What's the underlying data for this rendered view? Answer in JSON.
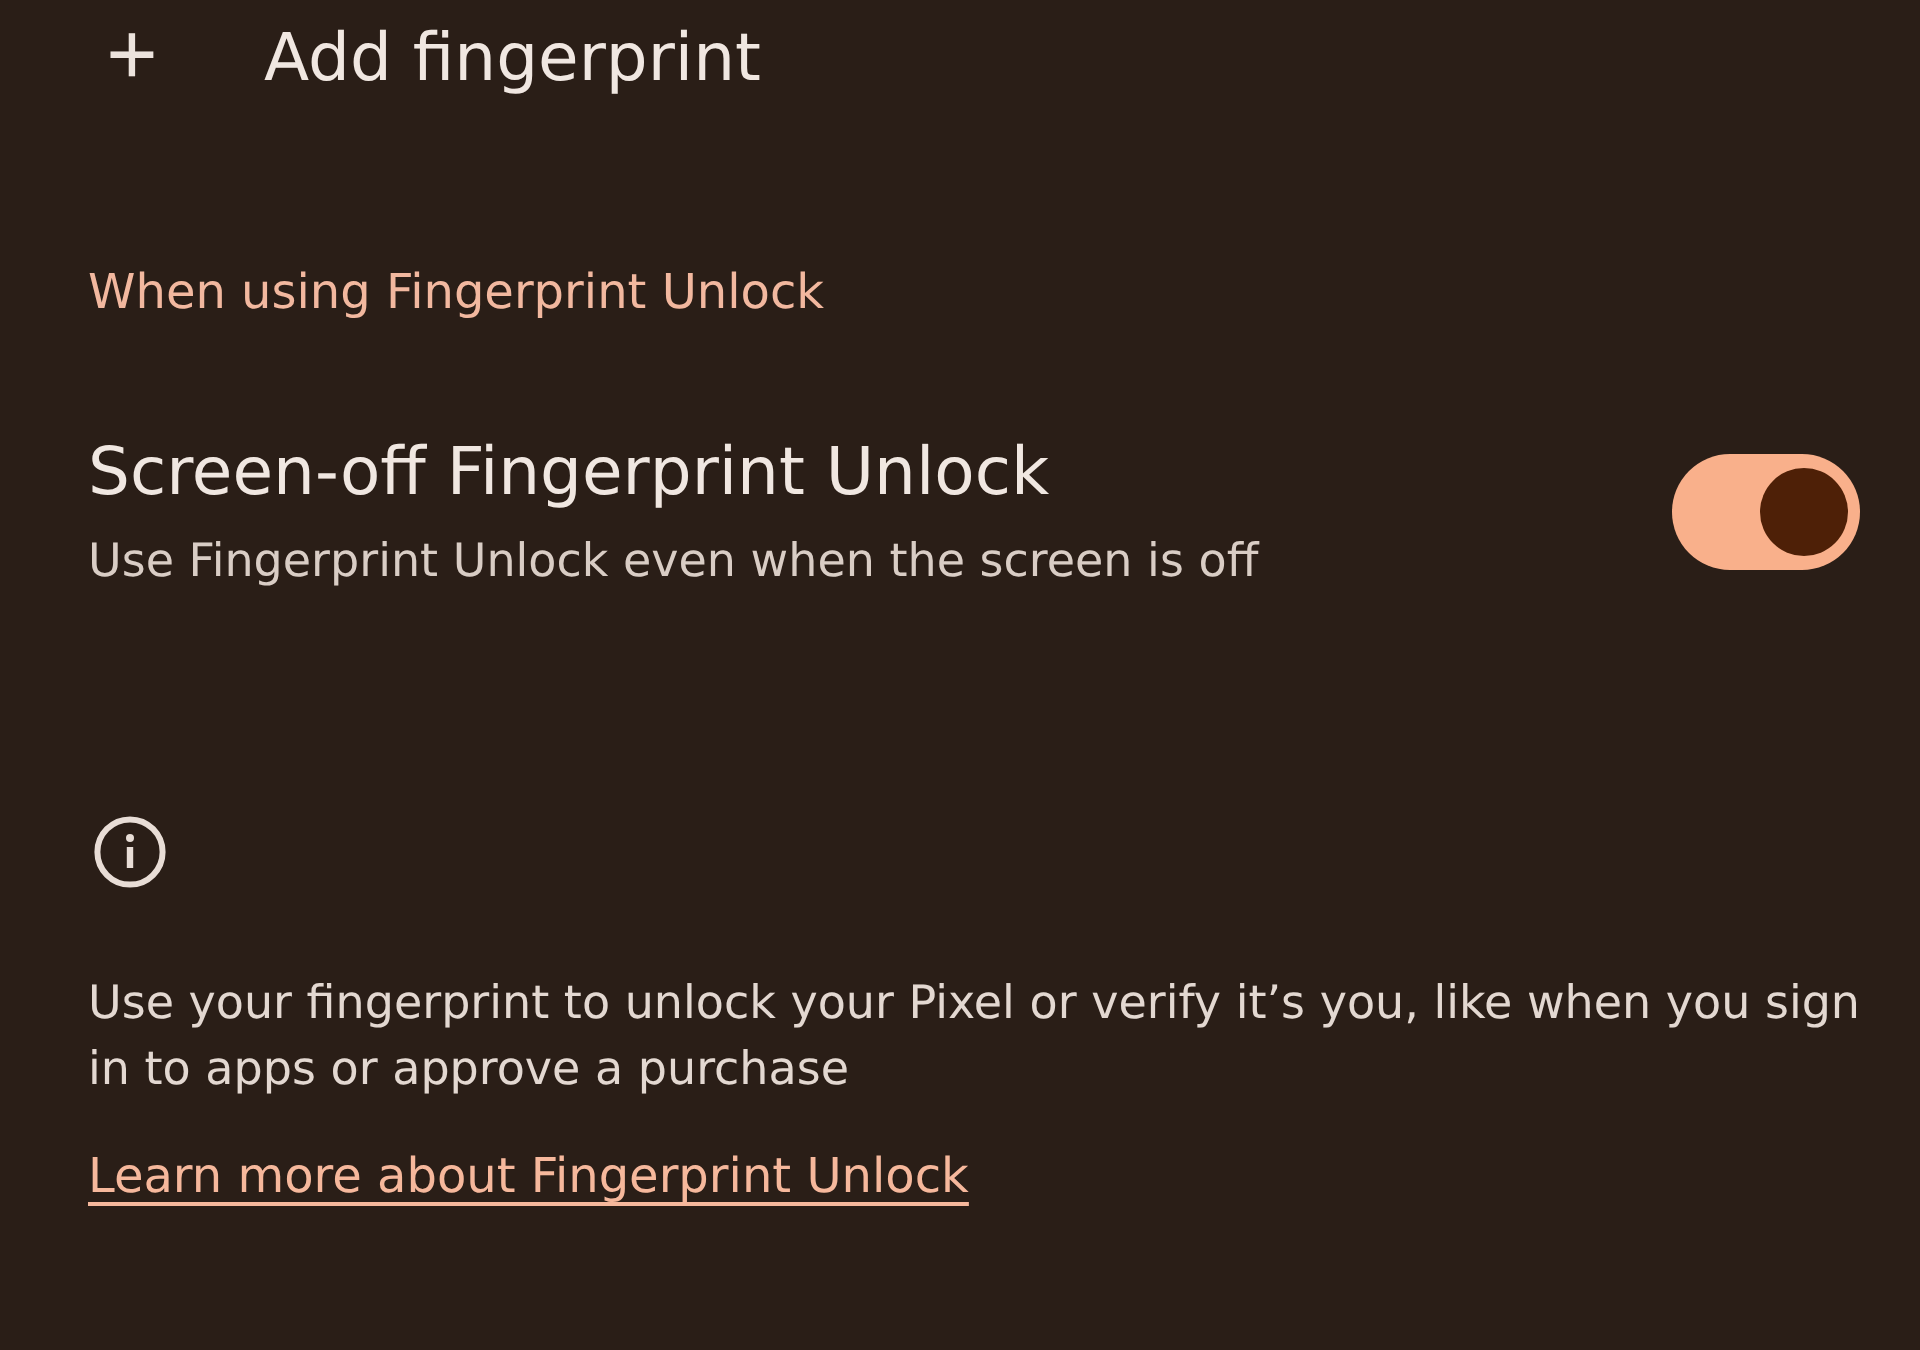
{
  "add_item": {
    "icon": "+",
    "label": "Add fingerprint"
  },
  "section_header": "When using Fingerprint Unlock",
  "settings": [
    {
      "title": "Screen-off Fingerprint Unlock",
      "summary": "Use Fingerprint Unlock even when the screen is off",
      "on": true
    }
  ],
  "footer": {
    "text": "Use your fingerprint to unlock your Pixel or verify it’s you, like when you sign in to apps or approve a purchase",
    "link": "Learn more about Fingerprint Unlock"
  }
}
